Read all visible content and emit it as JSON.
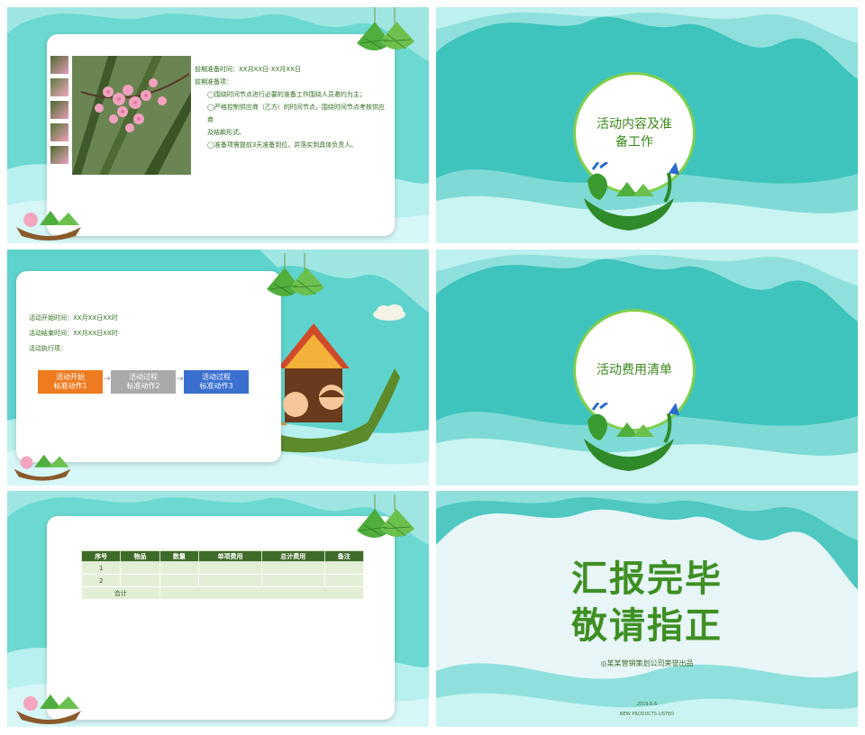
{
  "slide1": {
    "prep_time": "前期准备时间：XX月XX日-XX月XX日",
    "prep_items_label": "前期准备项：",
    "items": [
      "◯围绕时间节点进行必要的准备工作围绕人员邀约为主；",
      "◯严格控制供应商（乙方）的时间节点，围绕时间节点考核供应商",
      "及结款形式。",
      "◯准备项需提前3天准备到位，并落实到具体负责人。"
    ]
  },
  "slide2": {
    "title_line1": "活动内容及准",
    "title_line2": "备工作"
  },
  "slide3": {
    "start_time": "活动开始时间：XX月XX日XX时",
    "end_time": "活动结束时间：XX月XX日XX时",
    "exec_label": "活动执行项：",
    "flow": [
      {
        "line1": "活动开始",
        "line2": "标准动作1",
        "color": "#ee7b1f"
      },
      {
        "line1": "活动过程",
        "line2": "标准动作2",
        "color": "#a9a9a9"
      },
      {
        "line1": "活动过程",
        "line2": "标准动作3",
        "color": "#3a6fd0"
      }
    ],
    "arrow": "→"
  },
  "slide4": {
    "title": "活动费用清单"
  },
  "slide5": {
    "headers": [
      "序号",
      "物品",
      "数量",
      "单项费用",
      "总计费用",
      "备注"
    ],
    "rows": [
      [
        "1",
        "",
        "",
        "",
        "",
        ""
      ],
      [
        "2",
        "",
        "",
        "",
        "",
        ""
      ]
    ],
    "total_label": "合计"
  },
  "slide6": {
    "line1": "汇报完毕",
    "line2": "敬请指正",
    "company": "◎某某营销策划公司荣誉出品",
    "date": "2019.6.6",
    "footer": "NEW PRODUCTS LISTED"
  },
  "colors": {
    "teal": "#5ed3cd",
    "light_teal": "#bdf0ee",
    "green": "#3a8a1a",
    "dark_green": "#3f6b2a"
  }
}
